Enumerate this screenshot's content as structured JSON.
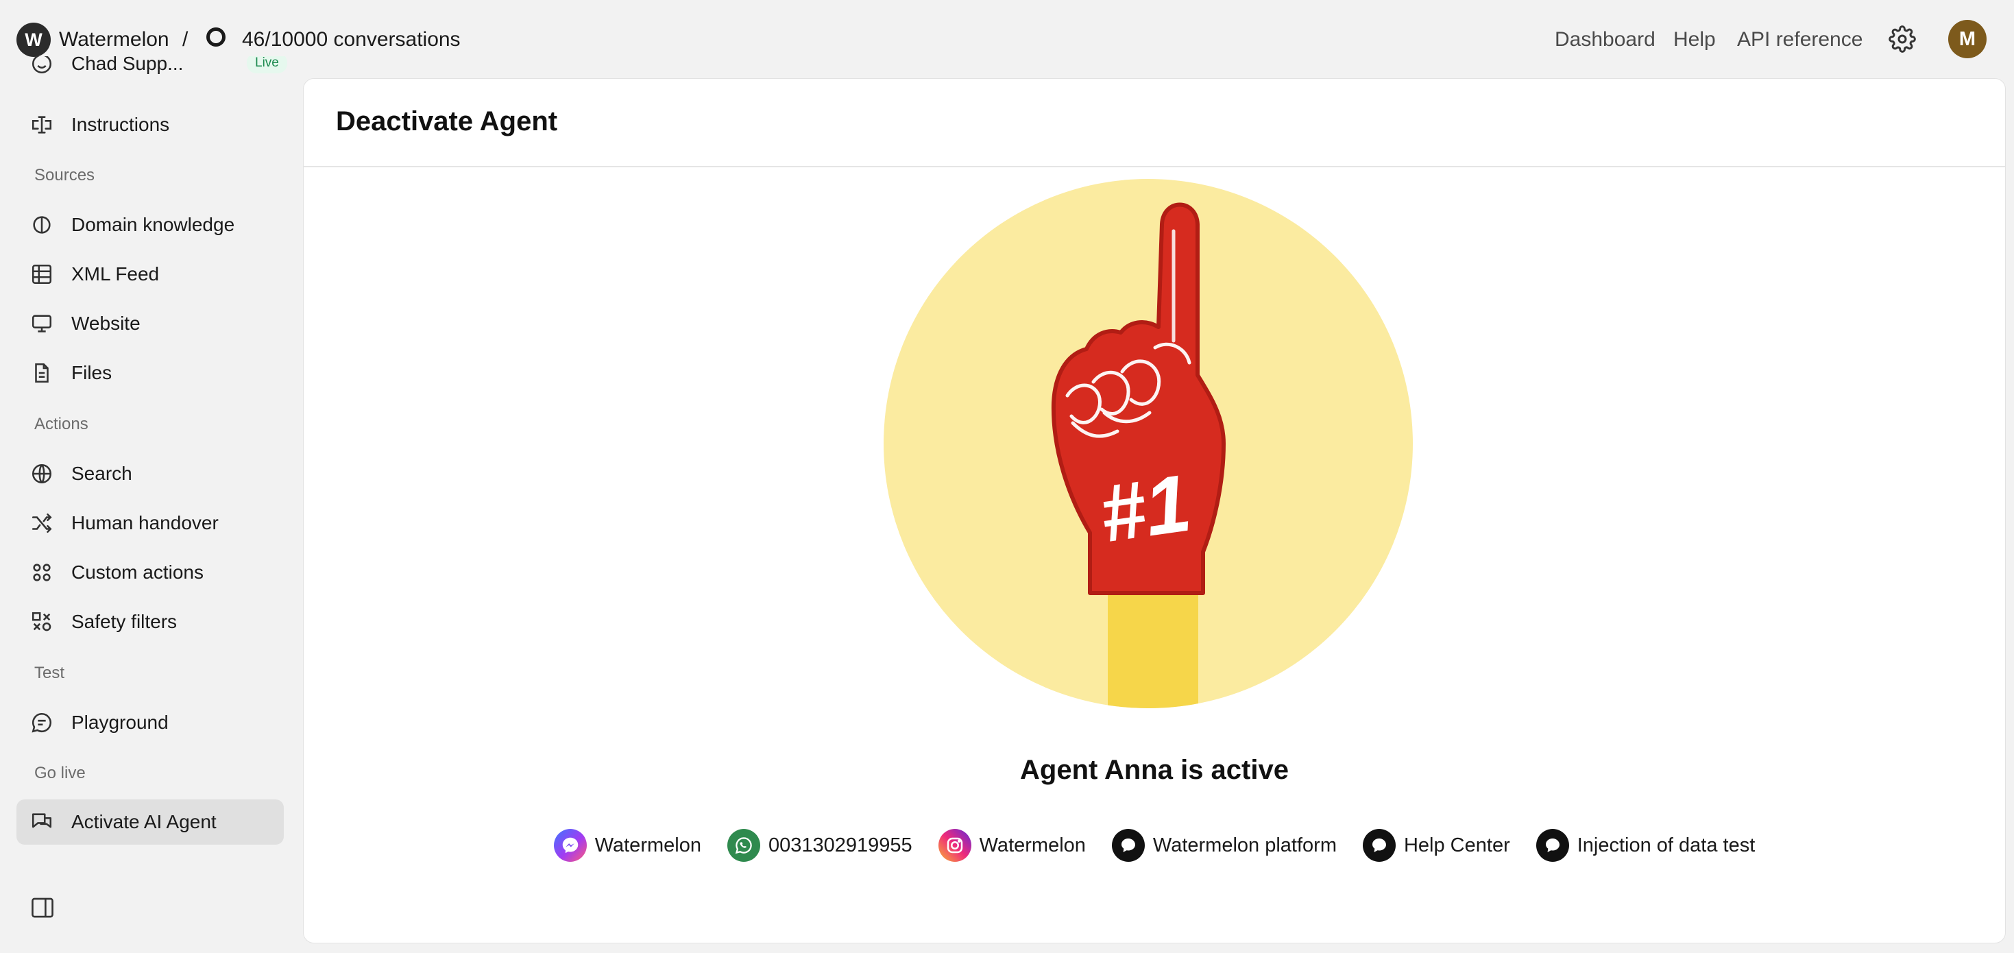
{
  "topbar": {
    "workspace_initial": "W",
    "workspace_name": "Watermelon",
    "separator": "/",
    "usage": "46/10000 conversations",
    "links": [
      "Dashboard",
      "Help",
      "API reference"
    ],
    "avatar_initial": "M",
    "avatar_color": "#7d5a1c"
  },
  "sidebar": {
    "agent_item": {
      "label": "Chad Supp...",
      "badge": "Live"
    },
    "instructions": "Instructions",
    "sections": {
      "sources": "Sources",
      "actions": "Actions",
      "test": "Test",
      "go_live": "Go live"
    },
    "sources": [
      "Domain knowledge",
      "XML Feed",
      "Website",
      "Files"
    ],
    "actions": [
      "Search",
      "Human handover",
      "Custom actions",
      "Safety filters"
    ],
    "test": [
      "Playground"
    ],
    "go_live": [
      "Activate AI Agent"
    ]
  },
  "main": {
    "title": "Deactivate Agent",
    "status": "Agent Anna is active",
    "illustration_text": "#1",
    "channels": [
      {
        "icon": "messenger-icon",
        "label": "Watermelon"
      },
      {
        "icon": "whatsapp-icon",
        "label": "0031302919955"
      },
      {
        "icon": "instagram-icon",
        "label": "Watermelon"
      },
      {
        "icon": "chat-bubble-icon",
        "label": "Watermelon platform"
      },
      {
        "icon": "chat-bubble-icon",
        "label": "Help Center"
      },
      {
        "icon": "chat-bubble-icon",
        "label": "Injection of data test"
      }
    ]
  },
  "colors": {
    "accent_active": "#e0e0e0",
    "live_badge": "#1c8a4f",
    "foam_finger": "#d62b1f",
    "circle_bg": "#fbeba0",
    "whatsapp": "#2f8a4e"
  }
}
